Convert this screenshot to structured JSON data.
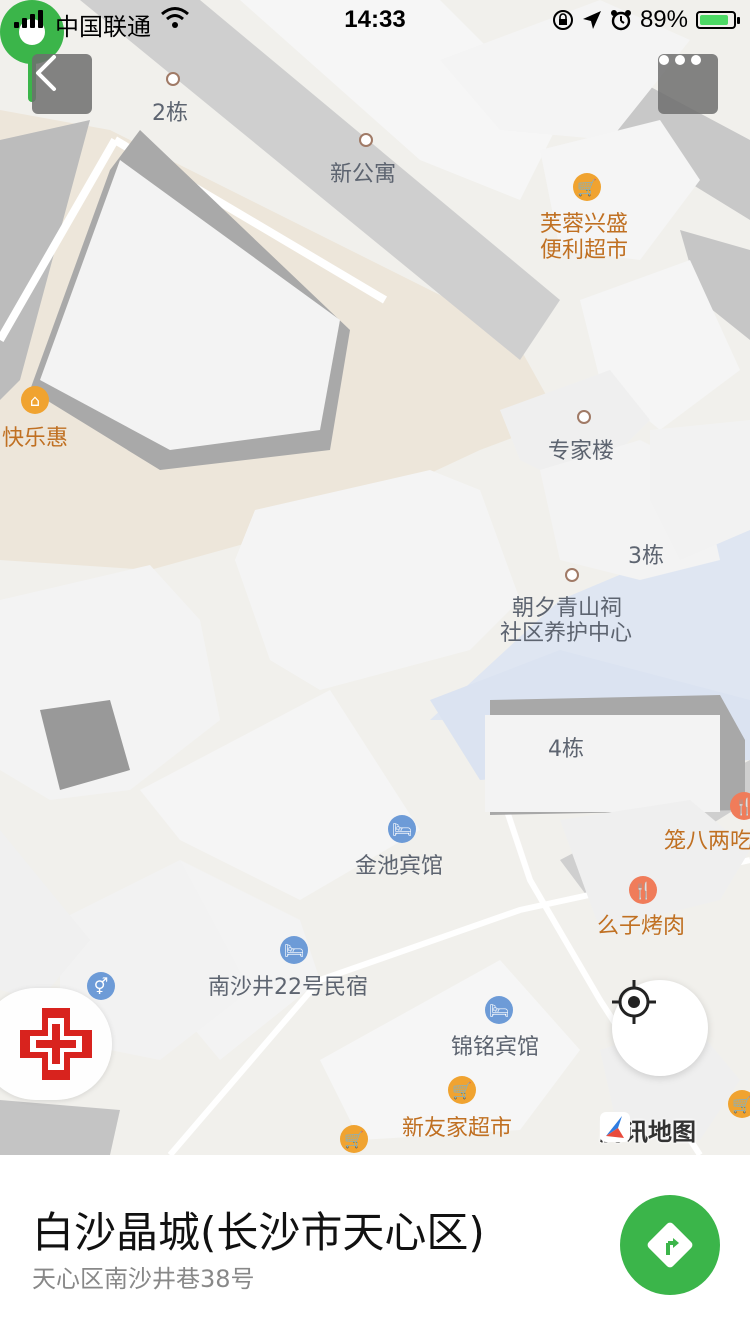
{
  "status_bar": {
    "carrier": "中国联通",
    "time": "14:33",
    "battery": "89%",
    "battery_level": 0.89
  },
  "map": {
    "labels": {
      "bldg_2": "2栋",
      "xin_gongyu": "新公寓",
      "furong_1": "芙蓉兴盛",
      "furong_2": "便利超市",
      "kuaile": "快乐惠",
      "zhuanjia": "专家楼",
      "bldg_3": "3栋",
      "zhaoxi_1": "朝夕青山祠",
      "zhaoxi_2": "社区养护中心",
      "bldg_4": "4栋",
      "longba": "笼八两吃",
      "jinchi": "金池宾馆",
      "yaozi": "么子烤肉",
      "nanshajing": "南沙井22号民宿",
      "jinming": "锦铭宾馆",
      "xinyoujia": "新友家超市"
    },
    "watermark": "腾讯地图"
  },
  "place": {
    "title": "白沙晶城(长沙市天心区)",
    "address": "天心区南沙井巷38号"
  },
  "colors": {
    "pin": "#3bb54a",
    "nav_button": "#3bb54a",
    "poi_orange": "#c07022"
  }
}
